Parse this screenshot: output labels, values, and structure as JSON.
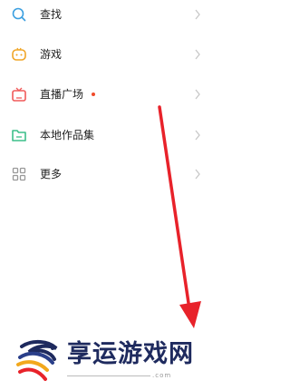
{
  "menu": {
    "items": [
      {
        "label": "查找",
        "icon": "search-icon",
        "icon_color": "#3b9fe0",
        "badge_dot": false
      },
      {
        "label": "游戏",
        "icon": "gamepad-icon",
        "icon_color": "#f0a526",
        "badge_dot": false
      },
      {
        "label": "直播广场",
        "icon": "live-tv-icon",
        "icon_color": "#f05a5a",
        "badge_dot": true
      },
      {
        "label": "本地作品集",
        "icon": "folder-icon",
        "icon_color": "#3dbf8a",
        "badge_dot": false
      },
      {
        "label": "更多",
        "icon": "grid-icon",
        "icon_color": "#999999",
        "badge_dot": false
      }
    ],
    "dot_color": "#f04a2a",
    "chevron_color": "#c8c8c8"
  },
  "overlay": {
    "arrow_color": "#e8222a"
  },
  "watermark": {
    "brand_text": "享运游戏网",
    "url_text": ".com"
  }
}
